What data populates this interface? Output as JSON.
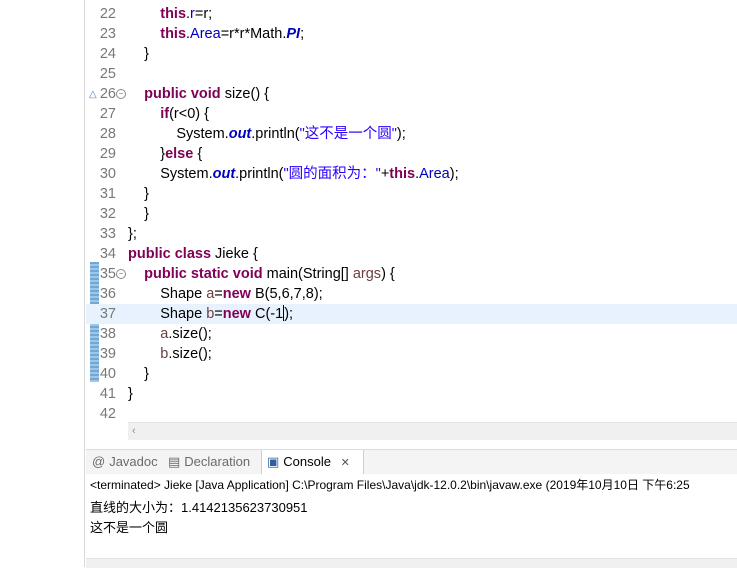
{
  "editor": {
    "lines": [
      {
        "num": "22",
        "indent": "        ",
        "tokens": [
          {
            "t": "this",
            "c": "kw"
          },
          {
            "t": ".",
            "c": ""
          },
          {
            "t": "r",
            "c": "fld"
          },
          {
            "t": "=r;",
            "c": ""
          }
        ]
      },
      {
        "num": "23",
        "indent": "        ",
        "tokens": [
          {
            "t": "this",
            "c": "kw"
          },
          {
            "t": ".",
            "c": ""
          },
          {
            "t": "Area",
            "c": "fld"
          },
          {
            "t": "=r*r*Math.",
            "c": ""
          },
          {
            "t": "PI",
            "c": "sfld"
          },
          {
            "t": ";",
            "c": ""
          }
        ]
      },
      {
        "num": "24",
        "indent": "    ",
        "tokens": [
          {
            "t": "}",
            "c": ""
          }
        ]
      },
      {
        "num": "25",
        "indent": "",
        "tokens": []
      },
      {
        "num": "26",
        "indent": "    ",
        "fold": true,
        "override": true,
        "tokens": [
          {
            "t": "public",
            "c": "kw"
          },
          {
            "t": " ",
            "c": ""
          },
          {
            "t": "void",
            "c": "kw"
          },
          {
            "t": " size() {",
            "c": ""
          }
        ]
      },
      {
        "num": "27",
        "indent": "        ",
        "tokens": [
          {
            "t": "if",
            "c": "kw"
          },
          {
            "t": "(r<0) {",
            "c": ""
          }
        ]
      },
      {
        "num": "28",
        "indent": "            ",
        "tokens": [
          {
            "t": "System.",
            "c": ""
          },
          {
            "t": "out",
            "c": "sfld"
          },
          {
            "t": ".println(",
            "c": ""
          },
          {
            "t": "\"这不是一个圆\"",
            "c": "str"
          },
          {
            "t": ");",
            "c": ""
          }
        ]
      },
      {
        "num": "29",
        "indent": "        ",
        "tokens": [
          {
            "t": "}",
            "c": ""
          },
          {
            "t": "else",
            "c": "kw"
          },
          {
            "t": " {",
            "c": ""
          }
        ]
      },
      {
        "num": "30",
        "indent": "        ",
        "tokens": [
          {
            "t": "System.",
            "c": ""
          },
          {
            "t": "out",
            "c": "sfld"
          },
          {
            "t": ".println(",
            "c": ""
          },
          {
            "t": "\"圆的面积为：\"",
            "c": "str"
          },
          {
            "t": "+",
            "c": ""
          },
          {
            "t": "this",
            "c": "kw"
          },
          {
            "t": ".",
            "c": ""
          },
          {
            "t": "Area",
            "c": "fld"
          },
          {
            "t": ");",
            "c": ""
          }
        ]
      },
      {
        "num": "31",
        "indent": "    ",
        "tokens": [
          {
            "t": "}",
            "c": ""
          }
        ]
      },
      {
        "num": "32",
        "indent": "    ",
        "tokens": [
          {
            "t": "}",
            "c": ""
          }
        ]
      },
      {
        "num": "33",
        "indent": "",
        "tokens": [
          {
            "t": "};",
            "c": ""
          }
        ]
      },
      {
        "num": "34",
        "indent": "",
        "tokens": [
          {
            "t": "public",
            "c": "kw"
          },
          {
            "t": " ",
            "c": ""
          },
          {
            "t": "class",
            "c": "kw"
          },
          {
            "t": " Jieke {",
            "c": ""
          }
        ]
      },
      {
        "num": "35",
        "indent": "    ",
        "fold": true,
        "tokens": [
          {
            "t": "public",
            "c": "kw"
          },
          {
            "t": " ",
            "c": ""
          },
          {
            "t": "static",
            "c": "kw"
          },
          {
            "t": " ",
            "c": ""
          },
          {
            "t": "void",
            "c": "kw"
          },
          {
            "t": " main(String[] ",
            "c": ""
          },
          {
            "t": "args",
            "c": "param"
          },
          {
            "t": ") {",
            "c": ""
          }
        ]
      },
      {
        "num": "36",
        "indent": "        ",
        "tokens": [
          {
            "t": "Shape ",
            "c": ""
          },
          {
            "t": "a",
            "c": "param"
          },
          {
            "t": "=",
            "c": ""
          },
          {
            "t": "new",
            "c": "kw"
          },
          {
            "t": " B(5,6,7,8);",
            "c": ""
          }
        ]
      },
      {
        "num": "37",
        "indent": "        ",
        "current": true,
        "tokens": [
          {
            "t": "Shape ",
            "c": ""
          },
          {
            "t": "b",
            "c": "param"
          },
          {
            "t": "=",
            "c": ""
          },
          {
            "t": "new",
            "c": "kw"
          },
          {
            "t": " C(",
            "c": ""
          },
          {
            "t": "-1",
            "c": ""
          },
          {
            "t": "caret",
            "c": "caret"
          },
          {
            "t": ");",
            "c": ""
          }
        ]
      },
      {
        "num": "38",
        "indent": "        ",
        "tokens": [
          {
            "t": "a",
            "c": "param"
          },
          {
            "t": ".size();",
            "c": ""
          }
        ]
      },
      {
        "num": "39",
        "indent": "        ",
        "tokens": [
          {
            "t": "b",
            "c": "param"
          },
          {
            "t": ".size();",
            "c": ""
          }
        ]
      },
      {
        "num": "40",
        "indent": "    ",
        "tokens": [
          {
            "t": "}",
            "c": ""
          }
        ]
      },
      {
        "num": "41",
        "indent": "",
        "tokens": [
          {
            "t": "}",
            "c": ""
          }
        ]
      },
      {
        "num": "42",
        "indent": "",
        "tokens": []
      }
    ],
    "hscroll_arrow": "‹"
  },
  "tabs": [
    {
      "label": "Javadoc",
      "icon": "@",
      "iconName": "javadoc-icon",
      "active": false
    },
    {
      "label": "Declaration",
      "icon": "▤",
      "iconName": "declaration-icon",
      "active": false
    },
    {
      "label": "Console",
      "icon": "▣",
      "iconName": "console-icon",
      "active": true,
      "close": "✕"
    }
  ],
  "console": {
    "terminated": "<terminated> Jieke [Java Application] C:\\Program Files\\Java\\jdk-12.0.2\\bin\\javaw.exe (2019年10月10日 下午6:25",
    "output": [
      "直线的大小为：1.4142135623730951",
      "这不是一个圆"
    ]
  }
}
